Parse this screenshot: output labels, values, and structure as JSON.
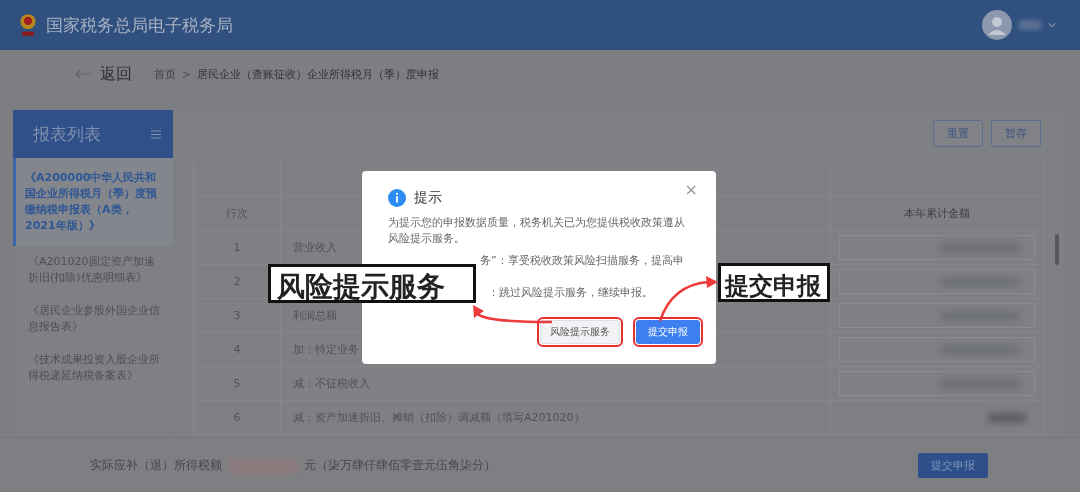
{
  "header": {
    "title": "国家税务总局电子税务局"
  },
  "breadcrumb": {
    "back": "返回",
    "home": "首页",
    "separator": ">",
    "current": "居民企业（查账征收）企业所得税月（季）度申报"
  },
  "sidebar": {
    "title": "报表列表",
    "items": [
      {
        "label": "《A200000中华人民共和国企业所得税月（季）度预缴纳税申报表（A类，2021年版）》",
        "selected": true
      },
      {
        "label": "《A201020固定资产加速折旧(扣除)优惠明细表》",
        "selected": false
      },
      {
        "label": "《居民企业参股外国企业信息报告表》",
        "selected": false
      },
      {
        "label": "《技术成果投资入股企业所得税递延纳税备案表》",
        "selected": false
      }
    ]
  },
  "toolbar": {
    "buttons": [
      "重置",
      "暂存"
    ]
  },
  "table": {
    "row_no_heading": "行次",
    "amount_heading": "本年累计金额",
    "rows": [
      {
        "no": "1",
        "name": "营业收入",
        "field": true
      },
      {
        "no": "2",
        "field": true
      },
      {
        "no": "3",
        "name": "利润总额",
        "field": true
      },
      {
        "no": "4",
        "name": "加：特定业务",
        "field": true
      },
      {
        "no": "5",
        "name": "减：不征税收入",
        "field": true
      },
      {
        "no": "6",
        "name": "减：资产加速折旧、摊销（扣除）调减额（填写A201020）",
        "field": false
      }
    ]
  },
  "footer": {
    "label": "实际应补（退）所得税额",
    "unit": "元（柒万肆仟肆佰零壹元伍角柒分）",
    "button": "提交申报"
  },
  "dialog": {
    "title": "提示",
    "close": "×",
    "paragraphs": [
      {
        "text": "为提示您的申报数据质量，税务机关已为您提供税收政策遵从风险提示服务。",
        "partial": false
      },
      {
        "text": "务”：享受税收政策风险扫描服务，提高申",
        "partial": true
      },
      {
        "text": "：跳过风险提示服务，继续申报。",
        "partial": true
      }
    ],
    "buttons": [
      {
        "label": "风险提示服务",
        "kind": "secondary"
      },
      {
        "label": "提交申报",
        "kind": "primary"
      }
    ]
  },
  "callouts": [
    "风险提示服务",
    "提交申报"
  ]
}
